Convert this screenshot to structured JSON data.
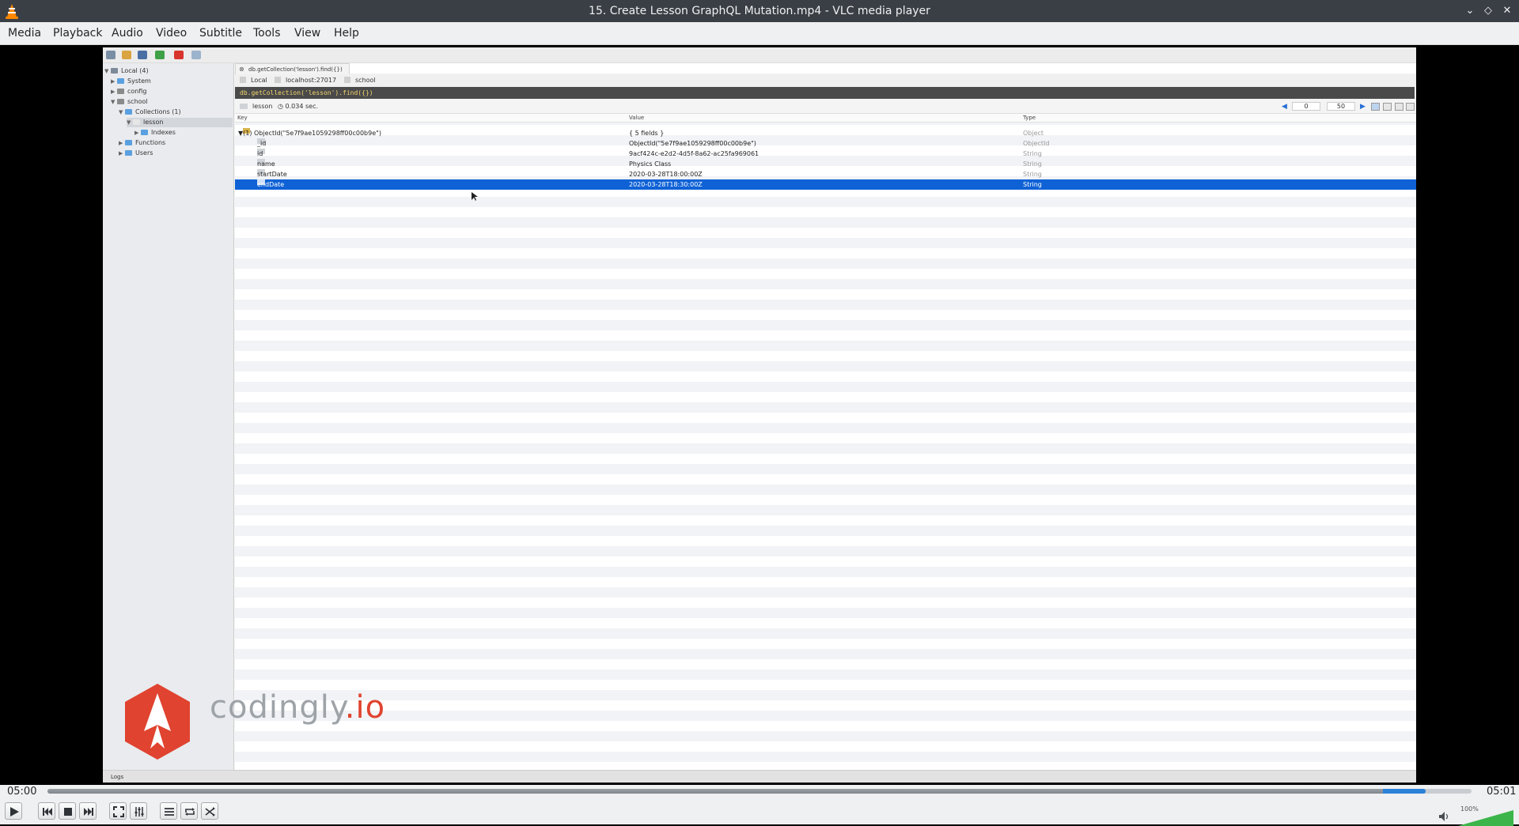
{
  "window": {
    "title": "15. Create Lesson GraphQL Mutation.mp4 - VLC media player"
  },
  "menu": [
    "Media",
    "Playback",
    "Audio",
    "Video",
    "Subtitle",
    "Tools",
    "View",
    "Help"
  ],
  "video_frame": {
    "tree": [
      {
        "label": "Local (4)"
      },
      {
        "label": "System"
      },
      {
        "label": "config"
      },
      {
        "label": "school"
      },
      {
        "label": "Collections (1)"
      },
      {
        "label": "lesson"
      },
      {
        "label": "Indexes"
      },
      {
        "label": "Functions"
      },
      {
        "label": "Users"
      }
    ],
    "tab_label": "db.getCollection('lesson').find({})",
    "breadcrumbs": {
      "connection": "Local",
      "host": "localhost:27017",
      "database": "school"
    },
    "query": "db.getCollection('lesson').find({})",
    "result_bar": {
      "collection": "lesson",
      "time": "0.034 sec.",
      "page_start": "0",
      "page_size": "50"
    },
    "columns": {
      "key": "Key",
      "value": "Value",
      "type": "Type"
    },
    "rows": [
      {
        "key": "(1) ObjectId(\"5e7f9ae1059298ff00c00b9e\")",
        "value": "{ 5 fields }",
        "type": "Object"
      },
      {
        "key": "_id",
        "value": "ObjectId(\"5e7f9ae1059298ff00c00b9e\")",
        "type": "ObjectId"
      },
      {
        "key": "id",
        "value": "9acf424c-e2d2-4d5f-8a62-ac25fa969061",
        "type": "String"
      },
      {
        "key": "name",
        "value": "Physics Class",
        "type": "String"
      },
      {
        "key": "startDate",
        "value": "2020-03-28T18:00:00Z",
        "type": "String"
      },
      {
        "key": "endDate",
        "value": "2020-03-28T18:30:00Z",
        "type": "String"
      }
    ],
    "watermark": {
      "name": "codingly",
      "tld": ".io"
    },
    "logs_label": "Logs"
  },
  "playback": {
    "elapsed": "05:00",
    "total": "05:01",
    "progress_fraction": 0.968,
    "volume_label": "100%",
    "volume_fraction": 1.0
  },
  "colors": {
    "accent": "#2b82d9",
    "vlc_orange": "#ff8800",
    "selection": "#0f62d6",
    "logo_red": "#e0432f"
  },
  "icons": {
    "play": "play-icon",
    "prev": "previous-icon",
    "stop": "stop-icon",
    "next": "next-icon",
    "fullscreen": "fullscreen-icon",
    "extended": "extended-settings-icon",
    "playlist": "playlist-icon",
    "loop": "loop-icon",
    "shuffle": "shuffle-icon",
    "volume": "speaker-icon"
  }
}
